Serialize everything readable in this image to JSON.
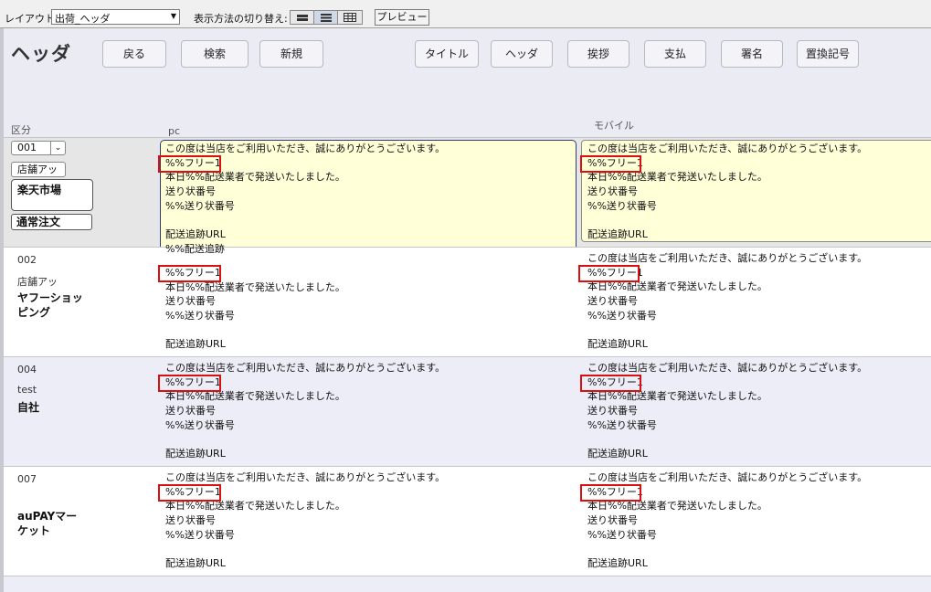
{
  "toolbar": {
    "layout_label": "レイアウト:",
    "layout_value": "出荷_ヘッダ",
    "view_label": "表示方法の切り替え:",
    "preview_label": "プレビュー"
  },
  "header": {
    "title": "ヘッダ",
    "buttons": {
      "back": "戻る",
      "search": "検索",
      "new": "新規",
      "title": "タイトル",
      "header": "ヘッダ",
      "greeting": "挨拶",
      "payment": "支払",
      "signature": "署名",
      "replace": "置換記号"
    },
    "col_kubun": "区分",
    "col_pc": "pc",
    "col_mobile": "モバイル"
  },
  "rows": [
    {
      "code": "001",
      "store": "店舗アッ",
      "mall": "楽天市場",
      "order_type": "通常注文",
      "pc": [
        "この度は当店をご利用いただき、誠にありがとうございます。",
        "%%フリー1",
        "本日%%配送業者で発送いたしました。",
        "送り状番号",
        "%%送り状番号",
        "",
        "配送追跡URL",
        "%%配送追跡"
      ],
      "mobile": [
        "この度は当店をご利用いただき、誠にありがとうございます。",
        "%%フリー1",
        "本日%%配送業者で発送いたしました。",
        "送り状番号",
        "%%送り状番号",
        "",
        "配送追跡URL"
      ]
    },
    {
      "code": "002",
      "store": "店舗アッ",
      "mall": "ヤフーショッピング",
      "pc": [
        "%%フリー1",
        "本日%%配送業者で発送いたしました。",
        "送り状番号",
        "%%送り状番号",
        "",
        "配送追跡URL"
      ],
      "mobile": [
        "この度は当店をご利用いただき、誠にありがとうございます。",
        "%%フリー1",
        "本日%%配送業者で発送いたしました。",
        "送り状番号",
        "%%送り状番号",
        "",
        "配送追跡URL"
      ]
    },
    {
      "code": "004",
      "store": "test",
      "mall": "自社",
      "pc": [
        "この度は当店をご利用いただき、誠にありがとうございます。",
        "%%フリー1",
        "本日%%配送業者で発送いたしました。",
        "送り状番号",
        "%%送り状番号",
        "",
        "配送追跡URL"
      ],
      "mobile": [
        "この度は当店をご利用いただき、誠にありがとうございます。",
        "%%フリー1",
        "本日%%配送業者で発送いたしました。",
        "送り状番号",
        "%%送り状番号",
        "",
        "配送追跡URL"
      ]
    },
    {
      "code": "007",
      "store": "",
      "mall": "auPAYマーケット",
      "pc": [
        "この度は当店をご利用いただき、誠にありがとうございます。",
        "%%フリー1",
        "本日%%配送業者で発送いたしました。",
        "送り状番号",
        "%%送り状番号",
        "",
        "配送追跡URL"
      ],
      "mobile": [
        "この度は当店をご利用いただき、誠にありがとうございます。",
        "%%フリー1",
        "本日%%配送業者で発送いたしました。",
        "送り状番号",
        "%%送り状番号",
        "",
        "配送追跡URL"
      ]
    }
  ],
  "colors": {
    "header_bg": "#ebebf3",
    "row_alt_bg": "#ededf7",
    "selected_row_bg": "#e6e6e6",
    "edit_bg": "#ffffd8",
    "highlight_border": "#d81010"
  }
}
